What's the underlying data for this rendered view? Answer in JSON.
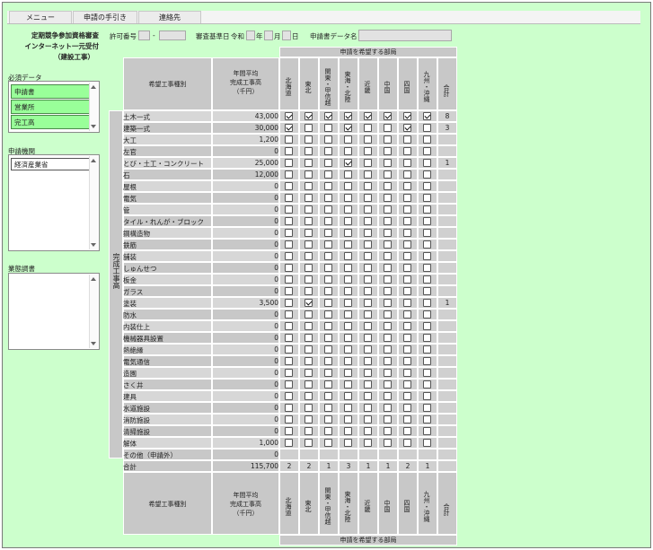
{
  "menu": [
    {
      "label": "メニュー"
    },
    {
      "label": "申請の手引き"
    },
    {
      "label": "連絡先"
    }
  ],
  "header": {
    "title_lines": [
      "定期競争参加資格審査",
      "インターネット一元受付",
      "（建設工事）"
    ],
    "permit_label": "許可番号",
    "permit_dash": "-",
    "review_label": "審査基準日",
    "era": "令和",
    "year_unit": "年",
    "month_unit": "月",
    "day_unit": "日",
    "data_name_label": "申請書データ名"
  },
  "sidebar": {
    "required_title": "必須データ",
    "required_items": [
      "申請書",
      "営業所",
      "完工高"
    ],
    "agency_title": "申請機関",
    "agency_items": [
      "経済産業省"
    ],
    "survey_title": "業態調書"
  },
  "table": {
    "dept_header": "申請を希望する部局",
    "col_kind": "希望工事種別",
    "col_avg_lines": [
      "年間平均",
      "完成工事高",
      "（千円）"
    ],
    "regions": [
      "北海道",
      "東北",
      "関東・甲信越",
      "東海・北陸",
      "近畿",
      "中国",
      "四国",
      "九州・沖縄"
    ],
    "total_col": "合計",
    "side_label": "完成工事高",
    "rows": [
      {
        "name": "土木一式",
        "value": "43,000",
        "checks": [
          1,
          1,
          1,
          1,
          1,
          1,
          1,
          1
        ],
        "total": "8"
      },
      {
        "name": "建築一式",
        "value": "30,000",
        "checks": [
          1,
          0,
          0,
          1,
          0,
          0,
          1,
          0
        ],
        "total": "3"
      },
      {
        "name": "大工",
        "value": "1,200",
        "checks": [
          0,
          0,
          0,
          0,
          0,
          0,
          0,
          0
        ],
        "total": ""
      },
      {
        "name": "左官",
        "value": "0",
        "checks": [
          0,
          0,
          0,
          0,
          0,
          0,
          0,
          0
        ],
        "total": ""
      },
      {
        "name": "とび・土工・コンクリート",
        "value": "25,000",
        "checks": [
          0,
          0,
          0,
          1,
          0,
          0,
          0,
          0
        ],
        "total": "1"
      },
      {
        "name": "石",
        "value": "12,000",
        "checks": [
          0,
          0,
          0,
          0,
          0,
          0,
          0,
          0
        ],
        "total": ""
      },
      {
        "name": "屋根",
        "value": "0",
        "checks": [
          0,
          0,
          0,
          0,
          0,
          0,
          0,
          0
        ],
        "total": ""
      },
      {
        "name": "電気",
        "value": "0",
        "checks": [
          0,
          0,
          0,
          0,
          0,
          0,
          0,
          0
        ],
        "total": ""
      },
      {
        "name": "管",
        "value": "0",
        "checks": [
          0,
          0,
          0,
          0,
          0,
          0,
          0,
          0
        ],
        "total": ""
      },
      {
        "name": "タイル・れんが・ブロック",
        "value": "0",
        "checks": [
          0,
          0,
          0,
          0,
          0,
          0,
          0,
          0
        ],
        "total": ""
      },
      {
        "name": "鋼構造物",
        "value": "0",
        "checks": [
          0,
          0,
          0,
          0,
          0,
          0,
          0,
          0
        ],
        "total": ""
      },
      {
        "name": "鉄筋",
        "value": "0",
        "checks": [
          0,
          0,
          0,
          0,
          0,
          0,
          0,
          0
        ],
        "total": ""
      },
      {
        "name": "舗装",
        "value": "0",
        "checks": [
          0,
          0,
          0,
          0,
          0,
          0,
          0,
          0
        ],
        "total": ""
      },
      {
        "name": "しゅんせつ",
        "value": "0",
        "checks": [
          0,
          0,
          0,
          0,
          0,
          0,
          0,
          0
        ],
        "total": ""
      },
      {
        "name": "板金",
        "value": "0",
        "checks": [
          0,
          0,
          0,
          0,
          0,
          0,
          0,
          0
        ],
        "total": ""
      },
      {
        "name": "ガラス",
        "value": "0",
        "checks": [
          0,
          0,
          0,
          0,
          0,
          0,
          0,
          0
        ],
        "total": ""
      },
      {
        "name": "塗装",
        "value": "3,500",
        "checks": [
          0,
          1,
          0,
          0,
          0,
          0,
          0,
          0
        ],
        "total": "1"
      },
      {
        "name": "防水",
        "value": "0",
        "checks": [
          0,
          0,
          0,
          0,
          0,
          0,
          0,
          0
        ],
        "total": ""
      },
      {
        "name": "内装仕上",
        "value": "0",
        "checks": [
          0,
          0,
          0,
          0,
          0,
          0,
          0,
          0
        ],
        "total": ""
      },
      {
        "name": "機械器具設置",
        "value": "0",
        "checks": [
          0,
          0,
          0,
          0,
          0,
          0,
          0,
          0
        ],
        "total": ""
      },
      {
        "name": "熱絶縁",
        "value": "0",
        "checks": [
          0,
          0,
          0,
          0,
          0,
          0,
          0,
          0
        ],
        "total": ""
      },
      {
        "name": "電気通信",
        "value": "0",
        "checks": [
          0,
          0,
          0,
          0,
          0,
          0,
          0,
          0
        ],
        "total": ""
      },
      {
        "name": "造園",
        "value": "0",
        "checks": [
          0,
          0,
          0,
          0,
          0,
          0,
          0,
          0
        ],
        "total": ""
      },
      {
        "name": "さく井",
        "value": "0",
        "checks": [
          0,
          0,
          0,
          0,
          0,
          0,
          0,
          0
        ],
        "total": ""
      },
      {
        "name": "建具",
        "value": "0",
        "checks": [
          0,
          0,
          0,
          0,
          0,
          0,
          0,
          0
        ],
        "total": ""
      },
      {
        "name": "水道施設",
        "value": "0",
        "checks": [
          0,
          0,
          0,
          0,
          0,
          0,
          0,
          0
        ],
        "total": ""
      },
      {
        "name": "消防施設",
        "value": "0",
        "checks": [
          0,
          0,
          0,
          0,
          0,
          0,
          0,
          0
        ],
        "total": ""
      },
      {
        "name": "清掃施設",
        "value": "0",
        "checks": [
          0,
          0,
          0,
          0,
          0,
          0,
          0,
          0
        ],
        "total": ""
      },
      {
        "name": "解体",
        "value": "1,000",
        "checks": [
          0,
          0,
          0,
          0,
          0,
          0,
          0,
          0
        ],
        "total": ""
      },
      {
        "name": "その他（申請外）",
        "value": "0",
        "checks": null,
        "total": ""
      }
    ],
    "sum_row": {
      "name": "合計",
      "value": "115,700",
      "totals": [
        "2",
        "2",
        "1",
        "3",
        "1",
        "1",
        "2",
        "1"
      ],
      "grand": ""
    }
  }
}
